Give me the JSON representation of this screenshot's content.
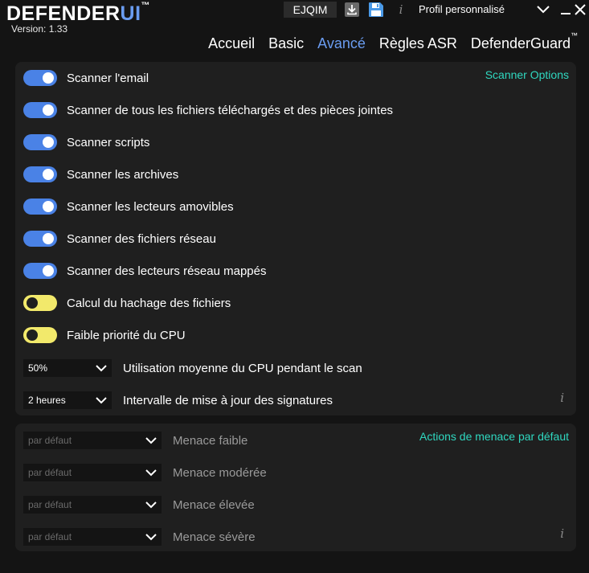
{
  "app": {
    "name_main": "DEFENDER",
    "name_accent": "UI",
    "trademark": "™",
    "version": "Version: 1.33"
  },
  "toolbar": {
    "profile_code": "EJQIM",
    "download_icon": "download-icon",
    "save_icon": "floppy-disk-icon",
    "info_icon": "info-icon",
    "info_glyph": "i",
    "profile_label": "Profil personnalisé"
  },
  "window": {
    "minimize_icon": "chevron-down-icon",
    "close_icon": "close-icon"
  },
  "nav": {
    "tabs": [
      {
        "label": "Accueil"
      },
      {
        "label": "Basic"
      },
      {
        "label": "Avancé"
      },
      {
        "label": "Règles ASR"
      },
      {
        "label": "DefenderGuard",
        "suffix": "™"
      }
    ],
    "active_index": 2
  },
  "scanner_panel": {
    "title": "Scanner Options",
    "toggles": [
      {
        "label": "Scanner l'email",
        "on": true
      },
      {
        "label": "Scanner de tous les fichiers téléchargés et des pièces jointes",
        "on": true
      },
      {
        "label": "Scanner scripts",
        "on": true
      },
      {
        "label": "Scanner les archives",
        "on": true
      },
      {
        "label": "Scanner les lecteurs amovibles",
        "on": true
      },
      {
        "label": "Scanner des fichiers réseau",
        "on": true
      },
      {
        "label": "Scanner des lecteurs réseau mappés",
        "on": true
      },
      {
        "label": "Calcul du hachage des fichiers",
        "on": false
      },
      {
        "label": "Faible priorité du CPU",
        "on": false
      }
    ],
    "selects": [
      {
        "value": "50%",
        "label": "Utilisation moyenne du CPU pendant le scan"
      },
      {
        "value": "2 heures",
        "label": "Intervalle de mise à jour des signatures"
      }
    ],
    "info_glyph": "i"
  },
  "threat_panel": {
    "title": "Actions de menace par défaut",
    "selects": [
      {
        "value": "par défaut",
        "label": "Menace faible"
      },
      {
        "value": "par défaut",
        "label": "Menace modérée"
      },
      {
        "value": "par défaut",
        "label": "Menace élevée"
      },
      {
        "value": "par défaut",
        "label": "Menace sévère"
      }
    ],
    "info_glyph": "i"
  },
  "colors": {
    "accent_blue": "#6a9cf0",
    "toggle_on": "#4a82e6",
    "toggle_off": "#f2e96b",
    "panel_title": "#2fd8c0",
    "background": "#141414",
    "panel": "#1f1f1f"
  }
}
